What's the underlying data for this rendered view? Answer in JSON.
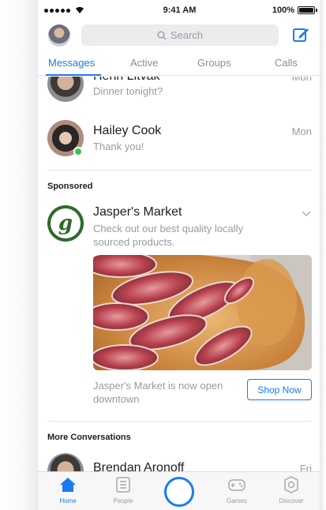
{
  "status_bar": {
    "time": "9:41 AM",
    "battery": "100%",
    "battery_level": 1.0
  },
  "header": {
    "search_placeholder": "Search"
  },
  "tabs": [
    {
      "label": "Messages",
      "active": true
    },
    {
      "label": "Active",
      "active": false
    },
    {
      "label": "Groups",
      "active": false
    },
    {
      "label": "Calls",
      "active": false
    }
  ],
  "conversations": [
    {
      "name": "Henri Litvak",
      "snippet": "Dinner tonight?",
      "date": "Mon"
    },
    {
      "name": "Hailey Cook",
      "snippet": "Thank you!",
      "date": "Mon",
      "online": true
    }
  ],
  "sponsored": {
    "section_title": "Sponsored",
    "advertiser": "Jasper's Market",
    "logo_letter": "g",
    "description": "Check out our best quality locally sourced products.",
    "footer_text": "Jasper's Market is now open downtown",
    "cta_label": "Shop Now"
  },
  "more_conversations": {
    "section_title": "More Conversations",
    "items": [
      {
        "name": "Brendan Aronoff",
        "date": "Fri"
      }
    ]
  },
  "tab_bar": [
    {
      "label": "Home",
      "icon": "home-icon",
      "active": true
    },
    {
      "label": "People",
      "icon": "people-icon",
      "active": false
    },
    {
      "label": "",
      "icon": "camera-icon",
      "active": false
    },
    {
      "label": "Games",
      "icon": "games-icon",
      "active": false
    },
    {
      "label": "Discover",
      "icon": "discover-icon",
      "active": false
    }
  ],
  "colors": {
    "accent": "#1a7bf0",
    "online": "#3ac24d",
    "brand_green": "#2e6b2a"
  }
}
